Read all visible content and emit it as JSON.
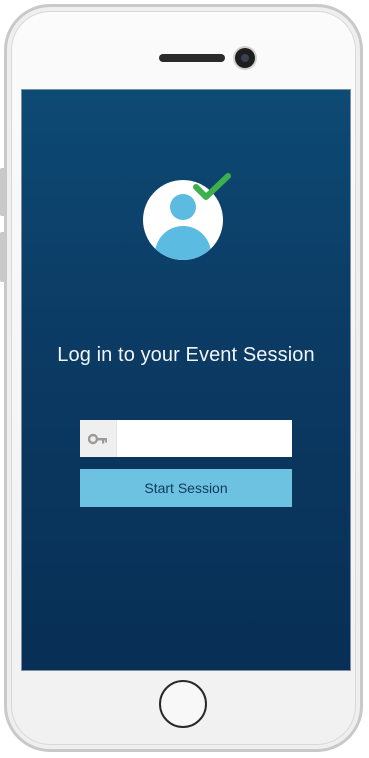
{
  "screen": {
    "title": "Log in to your Event Session",
    "session_input": {
      "value": "",
      "placeholder": ""
    },
    "start_button_label": "Start Session"
  },
  "icons": {
    "avatar": "user-avatar-icon",
    "check": "checkmark-icon",
    "key": "key-icon"
  },
  "colors": {
    "screen_background": "#0b3a63",
    "accent": "#6ec2e1",
    "check": "#3cb04a"
  }
}
